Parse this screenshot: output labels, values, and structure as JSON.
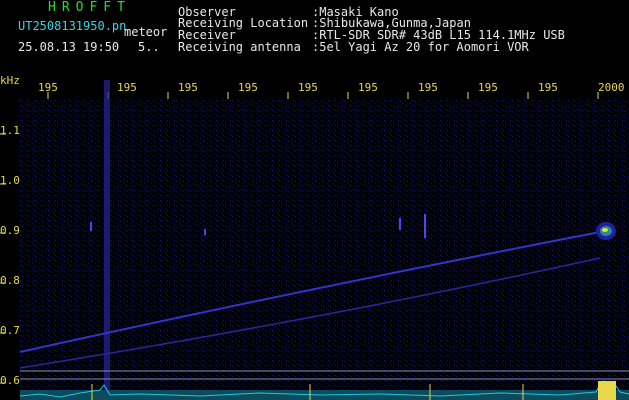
{
  "header": {
    "program": "HROFFT",
    "filename": "UT2508131950.pn",
    "mode": "meteor",
    "datetime": "25.08.13 19:50",
    "sample": "5..",
    "fields": [
      {
        "label": "Observer",
        "value": ":Masaki Kano"
      },
      {
        "label": "Receiving Location",
        "value": ":Shibukawa,Gunma,Japan"
      },
      {
        "label": "Receiver",
        "value": ":RTL-SDR SDR# 43dB L15 114.1MHz USB"
      },
      {
        "label": "Receiving antenna",
        "value": ":5el Yagi Az 20 for Aomori VOR"
      }
    ]
  },
  "spectrogram": {
    "y_unit": "kHz",
    "y_ticks": [
      "1.1",
      "1.0",
      "0.9",
      "0.8",
      "0.7",
      "0.6"
    ],
    "x_ticks": [
      "195",
      "195",
      "195",
      "195",
      "195",
      "195",
      "195",
      "195",
      "195",
      "2000"
    ],
    "colors": {
      "background": "#000000",
      "noise": "#1a1a8a",
      "signal": "#3a3ae0",
      "echo_hot": "#d8e03a",
      "axis_text": "#e6d84a",
      "baseline": "#20c8e0"
    }
  }
}
